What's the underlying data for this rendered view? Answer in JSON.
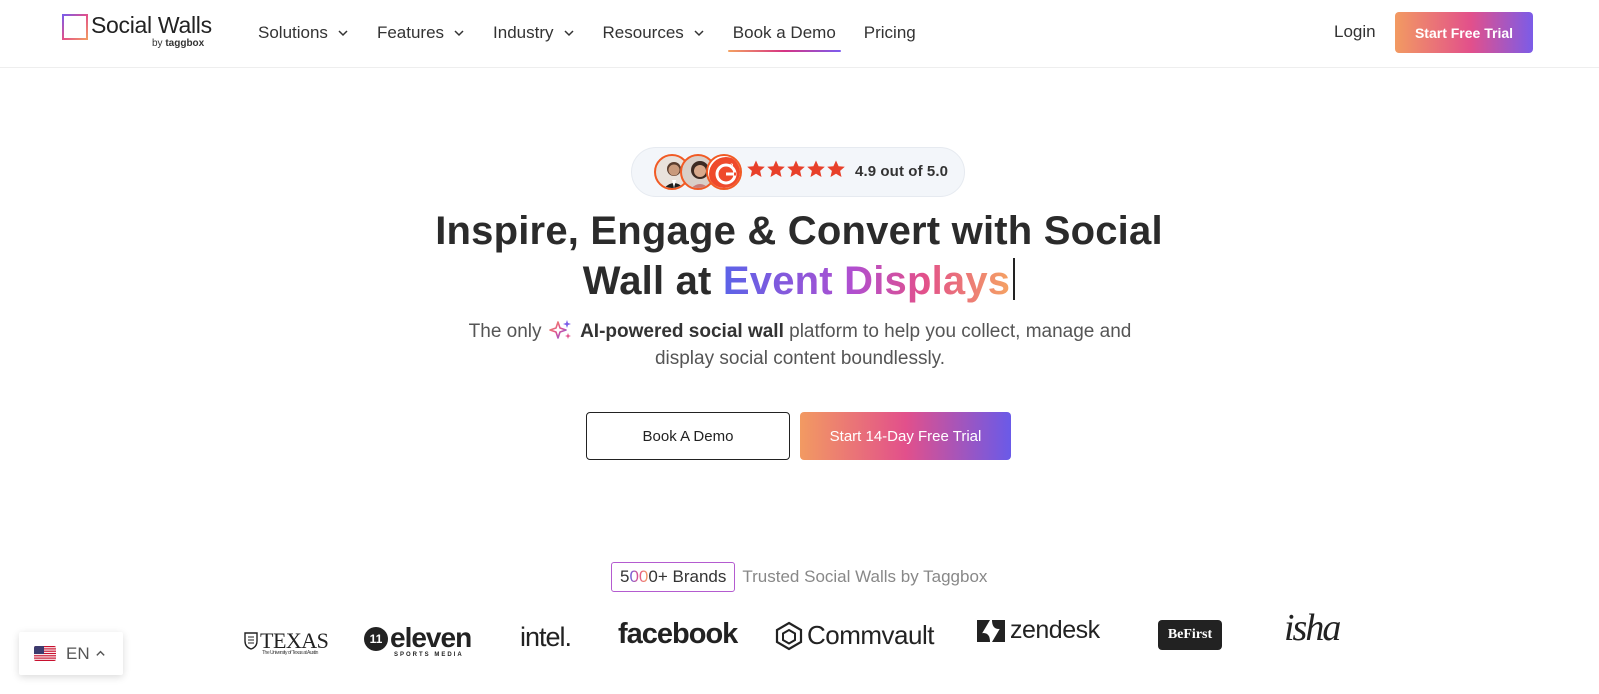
{
  "brand": {
    "name": "Social Walls",
    "by": "by",
    "parent": "taggbox"
  },
  "nav": {
    "items": [
      {
        "label": "Solutions",
        "dropdown": true
      },
      {
        "label": "Features",
        "dropdown": true
      },
      {
        "label": "Industry",
        "dropdown": true
      },
      {
        "label": "Resources",
        "dropdown": true
      },
      {
        "label": "Book a Demo",
        "dropdown": false,
        "active": true
      },
      {
        "label": "Pricing",
        "dropdown": false
      }
    ],
    "login": "Login",
    "cta": "Start Free Trial"
  },
  "rating": {
    "stars": 5,
    "text": "4.9 out of 5.0",
    "badge": "G2",
    "star_color": "#e8402a"
  },
  "hero": {
    "title_part1": "Inspire, Engage & Convert with Social Wall at ",
    "title_highlight": "Event Displays",
    "sub_pre": "The only",
    "sub_bold": "AI-powered social wall",
    "sub_post": "platform to help you collect, manage and display social content boundlessly.",
    "btn_demo": "Book A Demo",
    "btn_trial": "Start 14-Day Free Trial"
  },
  "trusted": {
    "count_first": "5",
    "count_grad": "00",
    "count_rest": "0+ Brands",
    "text": "Trusted Social Walls by Taggbox"
  },
  "logos": {
    "texas": "TEXAS",
    "texas_sub": "The University of Texas at Austin",
    "eleven": "eleven",
    "eleven_sub": "SPORTS MEDIA",
    "eleven_mark": "11",
    "intel": "intel.",
    "facebook": "facebook",
    "commvault": "Commvault",
    "zendesk": "zendesk",
    "befirst": "BeFirst",
    "isha": "isha"
  },
  "language": {
    "code": "EN"
  },
  "colors": {
    "accent_start": "#f29a62",
    "accent_mid": "#e2508b",
    "accent_end": "#7b5ce8"
  }
}
